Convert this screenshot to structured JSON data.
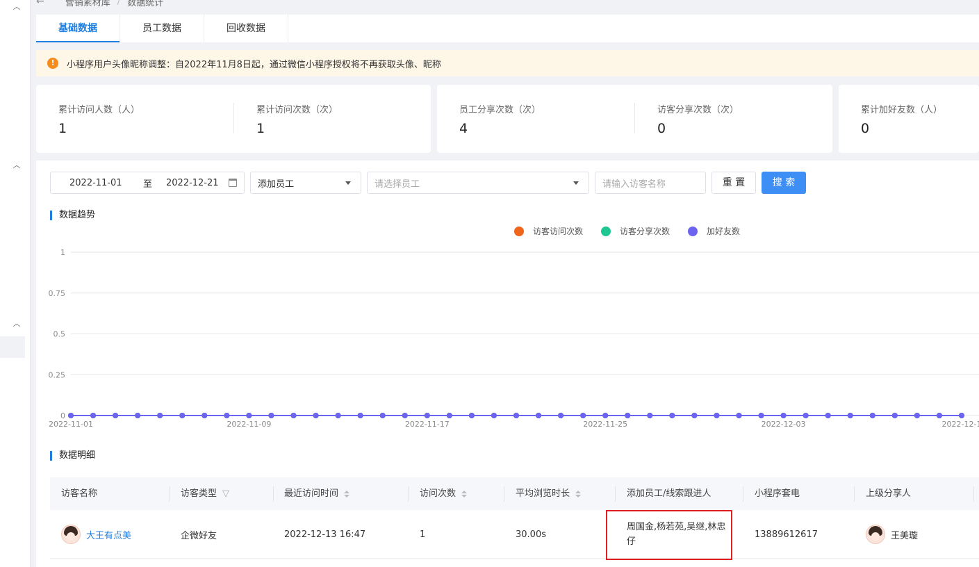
{
  "breadcrumb": [
    "营销素材库",
    "数据统计"
  ],
  "tabs": [
    {
      "label": "基础数据",
      "active": true
    },
    {
      "label": "员工数据",
      "active": false
    },
    {
      "label": "回收数据",
      "active": false
    }
  ],
  "notice": "小程序用户头像昵称调整：自2022年11月8日起，通过微信小程序授权将不再获取头像、昵称",
  "stats": [
    {
      "label": "累计访问人数（人）",
      "value": "1"
    },
    {
      "label": "累计访问次数（次）",
      "value": "1"
    },
    {
      "label": "员工分享次数（次）",
      "value": "4"
    },
    {
      "label": "访客分享次数（次）",
      "value": "0"
    },
    {
      "label": "累计加好友数（人）",
      "value": "0"
    }
  ],
  "filters": {
    "date_start": "2022-11-01",
    "date_sep": "至",
    "date_end": "2022-12-21",
    "employee_type": "添加员工",
    "employee_placeholder": "请选择员工",
    "visitor_placeholder": "请输入访客名称",
    "reset_label": "重 置",
    "search_label": "搜 索"
  },
  "sections": {
    "trend": "数据趋势",
    "detail": "数据明细"
  },
  "colors": {
    "accent": "#1f7fe0",
    "visits": "#f0651c",
    "shares": "#1ec691",
    "friends": "#6c63f0"
  },
  "chart_data": {
    "type": "line",
    "title": "",
    "x": [
      "2022-11-01",
      "2022-11-02",
      "2022-11-03",
      "2022-11-04",
      "2022-11-05",
      "2022-11-06",
      "2022-11-07",
      "2022-11-08",
      "2022-11-09",
      "2022-11-10",
      "2022-11-11",
      "2022-11-12",
      "2022-11-13",
      "2022-11-14",
      "2022-11-15",
      "2022-11-16",
      "2022-11-17",
      "2022-11-18",
      "2022-11-19",
      "2022-11-20",
      "2022-11-21",
      "2022-11-22",
      "2022-11-23",
      "2022-11-24",
      "2022-11-25",
      "2022-11-26",
      "2022-11-27",
      "2022-11-28",
      "2022-11-29",
      "2022-11-30",
      "2022-12-01",
      "2022-12-02",
      "2022-12-03",
      "2022-12-04",
      "2022-12-05",
      "2022-12-06",
      "2022-12-07",
      "2022-12-08",
      "2022-12-09",
      "2022-12-10",
      "2022-12-11"
    ],
    "x_tick_labels": [
      "2022-11-01",
      "2022-11-09",
      "2022-11-17",
      "2022-11-25",
      "2022-12-03",
      "2022-12-1"
    ],
    "y_ticks": [
      "0",
      "0.25",
      "0.5",
      "0.75",
      "1"
    ],
    "ylim": [
      0,
      1
    ],
    "legend_position": "top-center",
    "series": [
      {
        "name": "访客访问次数",
        "color": "#f0651c",
        "values": [
          0,
          0,
          0,
          0,
          0,
          0,
          0,
          0,
          0,
          0,
          0,
          0,
          0,
          0,
          0,
          0,
          0,
          0,
          0,
          0,
          0,
          0,
          0,
          0,
          0,
          0,
          0,
          0,
          0,
          0,
          0,
          0,
          0,
          0,
          0,
          0,
          0,
          0,
          0,
          0,
          0
        ]
      },
      {
        "name": "访客分享次数",
        "color": "#1ec691",
        "values": [
          0,
          0,
          0,
          0,
          0,
          0,
          0,
          0,
          0,
          0,
          0,
          0,
          0,
          0,
          0,
          0,
          0,
          0,
          0,
          0,
          0,
          0,
          0,
          0,
          0,
          0,
          0,
          0,
          0,
          0,
          0,
          0,
          0,
          0,
          0,
          0,
          0,
          0,
          0,
          0,
          0
        ]
      },
      {
        "name": "加好友数",
        "color": "#6c63f0",
        "values": [
          0,
          0,
          0,
          0,
          0,
          0,
          0,
          0,
          0,
          0,
          0,
          0,
          0,
          0,
          0,
          0,
          0,
          0,
          0,
          0,
          0,
          0,
          0,
          0,
          0,
          0,
          0,
          0,
          0,
          0,
          0,
          0,
          0,
          0,
          0,
          0,
          0,
          0,
          0,
          0,
          0
        ]
      }
    ]
  },
  "table": {
    "columns": [
      "访客名称",
      "访客类型",
      "最近访问时间",
      "访问次数",
      "平均浏览时长",
      "添加员工/线索跟进人",
      "小程序套电",
      "上级分享人"
    ],
    "rows": [
      {
        "visitor_name": "大王有点美",
        "visitor_type": "企微好友",
        "last_visit": "2022-12-13 16:47",
        "visit_count": "1",
        "avg_duration": "30.00s",
        "staff": "周国金,杨若苑,吴继,林忠仔",
        "phone": "13889612617",
        "sharer": "王美璇"
      }
    ]
  }
}
